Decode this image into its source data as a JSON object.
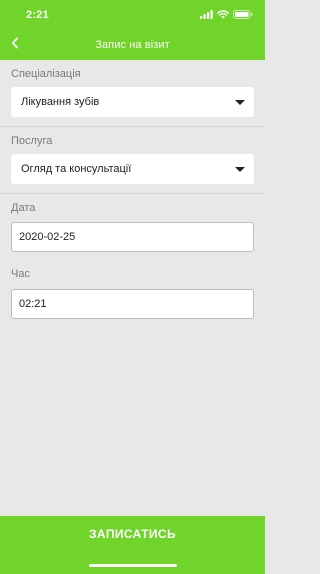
{
  "status_bar": {
    "time": "2:21"
  },
  "nav": {
    "title": "Запис на візит"
  },
  "form": {
    "specialization": {
      "label": "Спеціалізація",
      "value": "Лікування зубів"
    },
    "service": {
      "label": "Послуга",
      "value": "Огляд та консультації"
    },
    "date": {
      "label": "Дата",
      "value": "2020-02-25"
    },
    "time": {
      "label": "Час",
      "value": "02:21"
    }
  },
  "submit": {
    "label": "ЗАПИСАТИСЬ"
  },
  "colors": {
    "accent": "#71d42a",
    "background": "#e8e8e8"
  },
  "icons": {
    "status": [
      "signal-icon",
      "wifi-icon",
      "battery-icon"
    ],
    "nav": "chevron-left-icon",
    "select": "caret-down-icon"
  }
}
